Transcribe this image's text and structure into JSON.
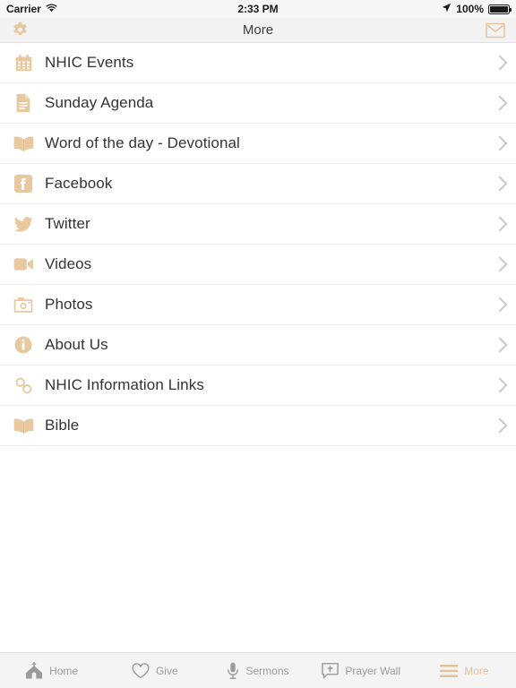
{
  "status_bar": {
    "carrier": "Carrier",
    "wifi_icon": "wifi-icon",
    "time": "2:33 PM",
    "location_icon": "location-arrow-icon",
    "battery_percent": "100%",
    "battery_icon": "battery-full-icon"
  },
  "nav_bar": {
    "title": "More",
    "left_icon": "gear-icon",
    "right_icon": "envelope-icon"
  },
  "colors": {
    "accent": "#e4c49a",
    "accent_icon": "#e8c89f",
    "text": "#333333",
    "chevron": "#c9c9c9",
    "tab_inactive": "#9b9b9b",
    "navbar_bg": "#f2f2f2",
    "tabbar_bg": "#f4f4f4",
    "separator": "#ededed"
  },
  "list": {
    "items": [
      {
        "label": "NHIC Events",
        "icon": "calendar-icon"
      },
      {
        "label": "Sunday Agenda",
        "icon": "document-icon"
      },
      {
        "label": "Word of the day - Devotional",
        "icon": "open-book-icon"
      },
      {
        "label": "Facebook",
        "icon": "facebook-icon"
      },
      {
        "label": "Twitter",
        "icon": "twitter-bird-icon"
      },
      {
        "label": "Videos",
        "icon": "video-camera-icon"
      },
      {
        "label": "Photos",
        "icon": "camera-icon"
      },
      {
        "label": "About Us",
        "icon": "info-circle-icon"
      },
      {
        "label": "NHIC Information Links",
        "icon": "link-chain-icon"
      },
      {
        "label": "Bible",
        "icon": "open-book-icon"
      }
    ],
    "accessory_icon": "chevron-right-icon"
  },
  "tab_bar": {
    "tabs": [
      {
        "label": "Home",
        "icon": "church-icon",
        "active": false
      },
      {
        "label": "Give",
        "icon": "heart-icon",
        "active": false
      },
      {
        "label": "Sermons",
        "icon": "microphone-icon",
        "active": false
      },
      {
        "label": "Prayer Wall",
        "icon": "speech-cross-icon",
        "active": false
      },
      {
        "label": "More",
        "icon": "hamburger-menu-icon",
        "active": true
      }
    ]
  }
}
